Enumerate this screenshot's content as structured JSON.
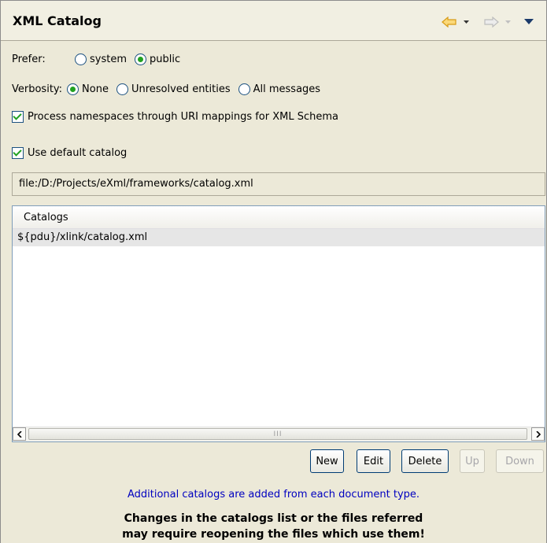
{
  "header": {
    "title": "XML Catalog"
  },
  "prefer": {
    "label": "Prefer:",
    "options": [
      "system",
      "public"
    ],
    "selected": "public"
  },
  "verbosity": {
    "label": "Verbosity:",
    "options": [
      "None",
      "Unresolved entities",
      "All messages"
    ],
    "selected": "None"
  },
  "namespaces_check": {
    "label": "Process namespaces through URI mappings for XML Schema",
    "checked": true
  },
  "default_catalog_check": {
    "label": "Use default catalog",
    "checked": true
  },
  "default_catalog_path": "file:/D:/Projects/eXml/frameworks/catalog.xml",
  "catalogs_table": {
    "header": "Catalogs",
    "rows": [
      "${pdu}/xlink/catalog.xml"
    ],
    "scroll_grip": "III"
  },
  "buttons": {
    "new": "New",
    "edit": "Edit",
    "delete": "Delete",
    "up": "Up",
    "down": "Down"
  },
  "notes": {
    "additional": "Additional catalogs are added from each document type.",
    "warning_line1": "Changes in the catalogs list or the files referred",
    "warning_line2": "may require reopening the files which use them!"
  },
  "colors": {
    "radio_dot": "#21a121",
    "note_blue": "#0000c0",
    "back_arrow": "#f0b030"
  },
  "icons": [
    "back-arrow-icon",
    "forward-arrow-icon",
    "menu-dropdown-icon"
  ]
}
